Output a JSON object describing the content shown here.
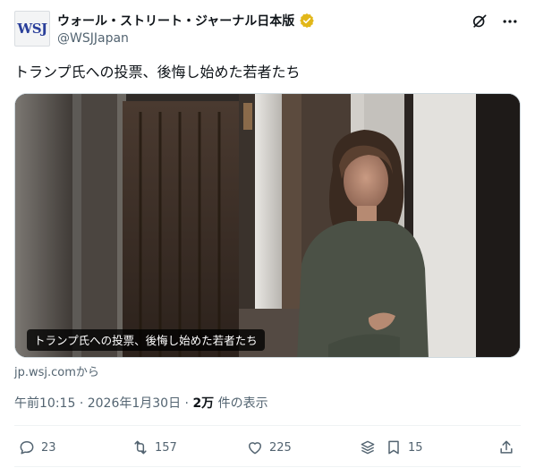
{
  "author": {
    "avatar_text": "WSJ",
    "display_name": "ウォール・ストリート・ジャーナル日本版",
    "handle": "@WSJJapan",
    "verified_color": "#e2b719"
  },
  "tweet": {
    "text": "トランプ氏への投票、後悔し始めた若者たち",
    "media_caption": "トランプ氏への投票、後悔し始めた若者たち",
    "source_label": "jp.wsj.comから"
  },
  "meta": {
    "time": "午前10:15",
    "date": "2026年1月30日",
    "views_count": "2万",
    "views_label": "件の表示",
    "separator": "·"
  },
  "actions": {
    "replies": "23",
    "reposts": "157",
    "likes": "225",
    "bookmarks": "15"
  },
  "icons": {
    "grok": "grok-icon",
    "more": "more-icon",
    "reply": "reply-icon",
    "repost": "repost-icon",
    "like": "heart-icon",
    "analytics": "layers-icon",
    "bookmark": "bookmark-icon",
    "share": "share-icon"
  },
  "colors": {
    "text_primary": "#0f1419",
    "text_secondary": "#536471",
    "border": "#cfd9de"
  }
}
